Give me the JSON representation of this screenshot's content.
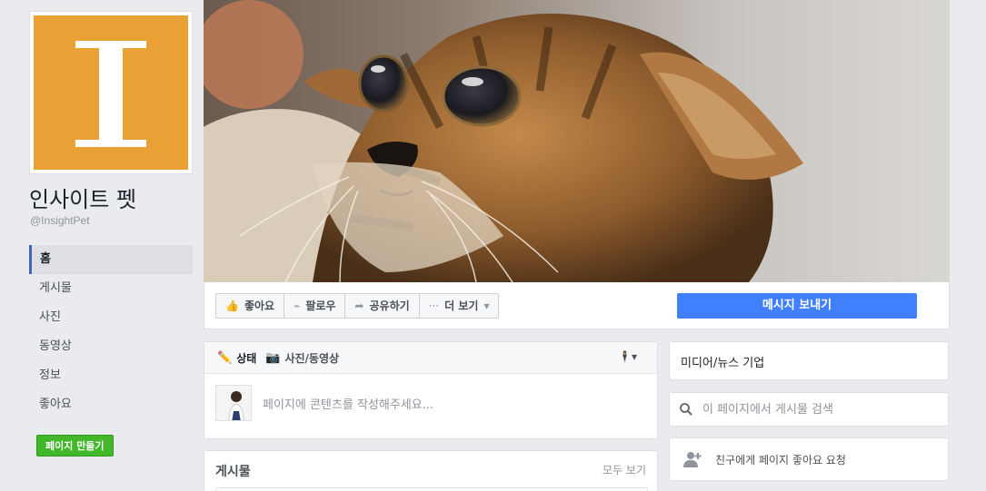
{
  "page": {
    "logo_letter": "I",
    "name": "인사이트 펫",
    "handle": "@InsightPet",
    "create_page_label": "페이지 만들기"
  },
  "nav": {
    "items": [
      {
        "label": "홈",
        "active": true
      },
      {
        "label": "게시물"
      },
      {
        "label": "사진"
      },
      {
        "label": "동영상"
      },
      {
        "label": "정보"
      },
      {
        "label": "좋아요"
      }
    ]
  },
  "actions": {
    "like": "좋아요",
    "follow": "팔로우",
    "share": "공유하기",
    "more": "더 보기",
    "message": "메시지 보내기"
  },
  "composer": {
    "tab_status": "상태",
    "tab_photo": "사진/동영상",
    "placeholder": "페이지에 콘텐츠를 작성해주세요..."
  },
  "posts": {
    "title": "게시물",
    "see_all": "모두 보기"
  },
  "sidebar": {
    "category": "미디어/뉴스 기업",
    "search_placeholder": "이 페이지에서 게시물 검색",
    "invite": "친구에게 페이지 좋아요 요청"
  },
  "colors": {
    "logo_bg": "#e9a034",
    "primary_button": "#4080ff",
    "create_button": "#42b72a",
    "nav_active_border": "#4267b2"
  },
  "icons": [
    "thumbs-up-icon",
    "rss-icon",
    "share-arrow-icon",
    "ellipsis-icon",
    "chevron-down-icon",
    "pencil-icon",
    "camera-icon",
    "search-icon",
    "add-friend-icon"
  ]
}
